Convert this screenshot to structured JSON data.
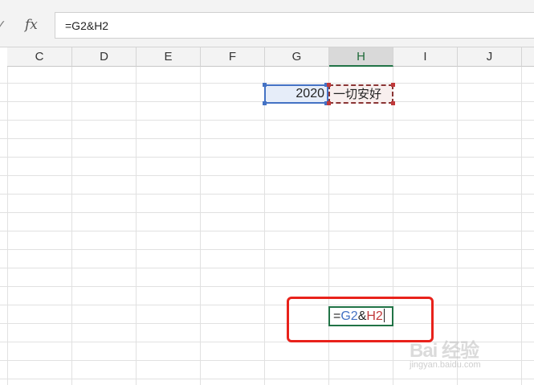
{
  "formula_bar": {
    "fx_label": "fx",
    "check_glyph": "✓",
    "formula": "=G2&H2"
  },
  "columns": [
    "C",
    "D",
    "E",
    "F",
    "G",
    "H",
    "I",
    "J"
  ],
  "selected_column": "H",
  "cells": {
    "G2": "2020",
    "H2": "一切安好"
  },
  "edit_cell": {
    "eq": "=",
    "ref1": "G2",
    "amp": "&",
    "ref2": "H2"
  },
  "watermark": {
    "main": "Bai 经验",
    "sub": "jingyan.baidu.com"
  },
  "colors": {
    "ref_blue": "#4472c4",
    "ref_red": "#c0393b",
    "highlight": "#e8221b",
    "excel_green": "#217346"
  }
}
